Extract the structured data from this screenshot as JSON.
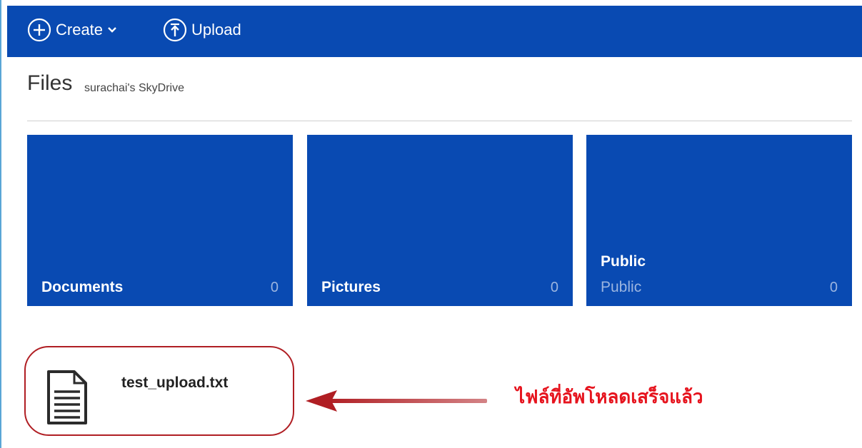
{
  "toolbar": {
    "create_label": "Create",
    "upload_label": "Upload",
    "create_icon": "plus-circle-icon",
    "upload_icon": "upload-circle-icon"
  },
  "header": {
    "title": "Files",
    "drive_name": "surachai's SkyDrive"
  },
  "folders": [
    {
      "name": "Documents",
      "subtitle": "",
      "count": "0"
    },
    {
      "name": "Pictures",
      "subtitle": "",
      "count": "0"
    },
    {
      "name": "Public",
      "subtitle": "Public",
      "count": "0"
    }
  ],
  "files": [
    {
      "name": "test_upload.txt",
      "icon": "text-file-icon"
    }
  ],
  "annotation": {
    "text": "ไฟล์ที่อัพโหลดเสร็จแล้ว",
    "color": "#e6141e"
  },
  "colors": {
    "brand": "#094ab2",
    "highlight": "#b01e23"
  }
}
